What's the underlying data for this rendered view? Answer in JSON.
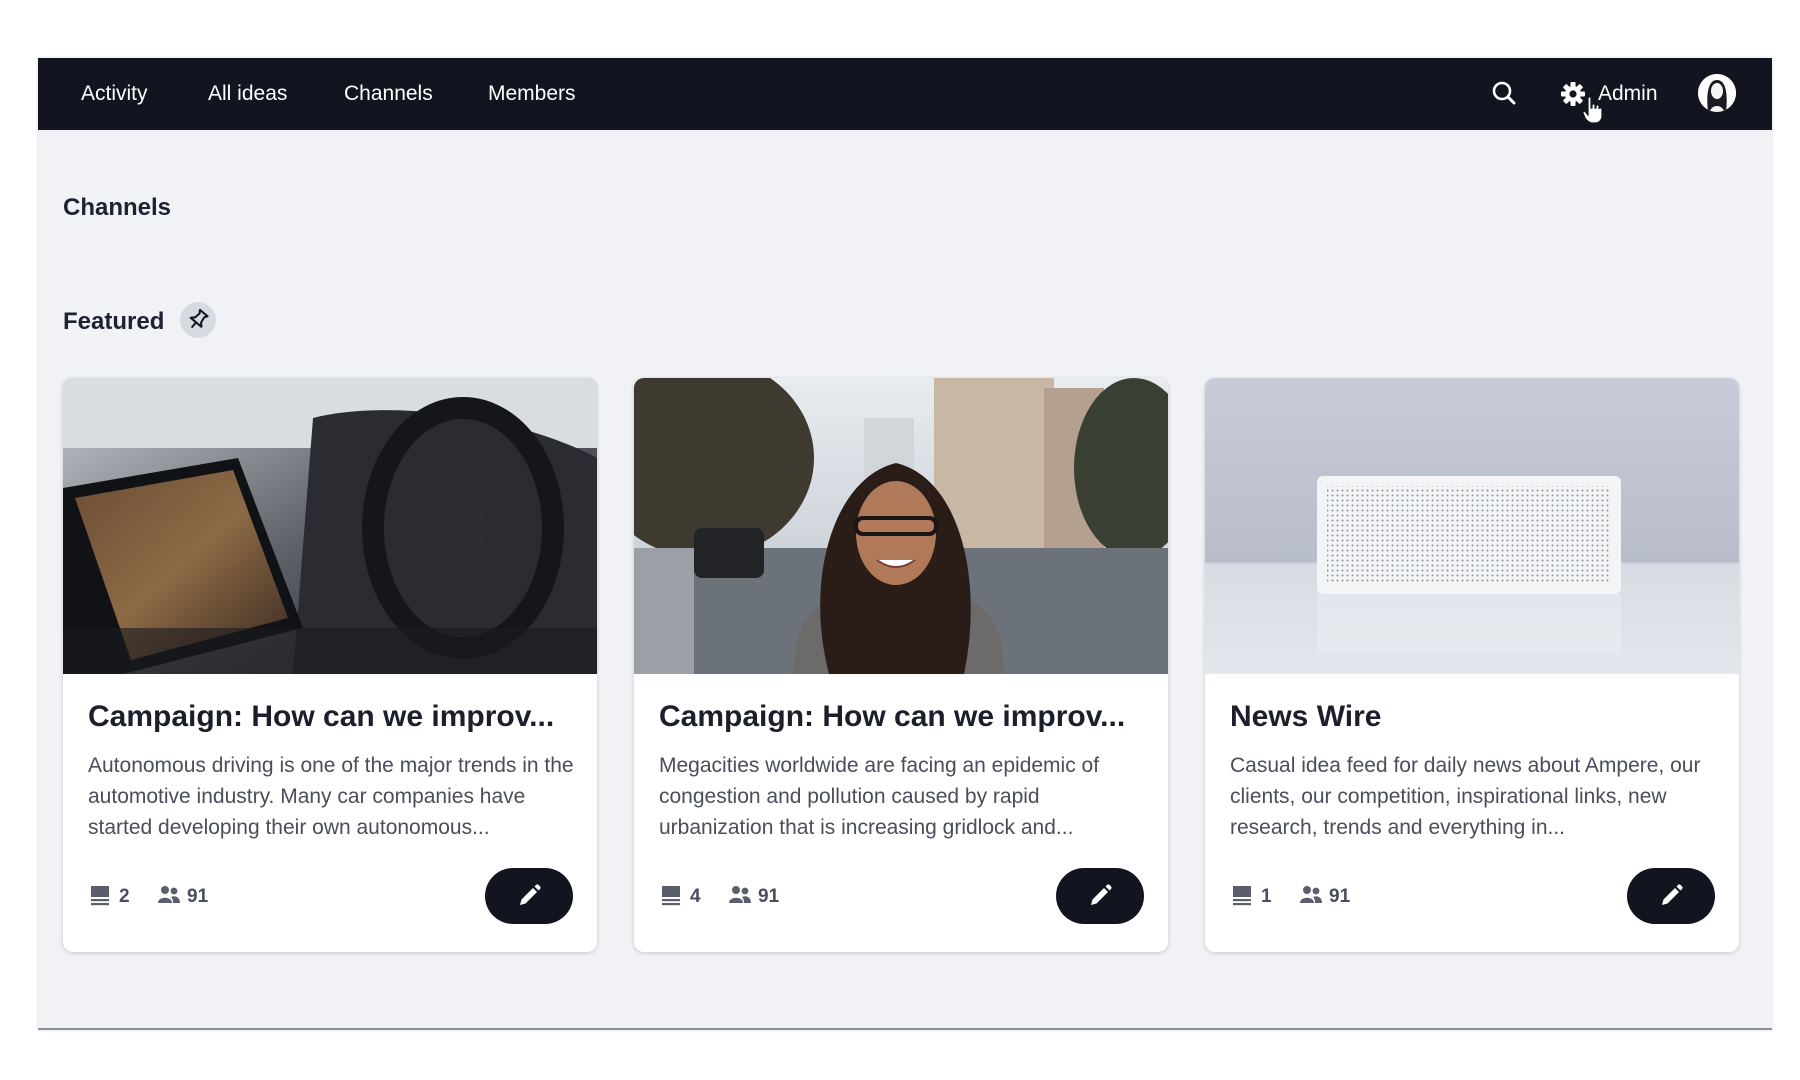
{
  "nav": {
    "items": [
      {
        "label": "Activity"
      },
      {
        "label": "All ideas"
      },
      {
        "label": "Channels"
      },
      {
        "label": "Members"
      }
    ],
    "admin_label": "Admin"
  },
  "page": {
    "title": "Channels",
    "featured_label": "Featured"
  },
  "cards": [
    {
      "title": "Campaign: How can we improv...",
      "description": "Autonomous driving is one of the major trends in the automotive industry. Many car companies have started developing their own autonomous...",
      "ideas_count": "2",
      "members_count": "91",
      "image": "car-interior-photo"
    },
    {
      "title": "Campaign: How can we improv...",
      "description": "Megacities worldwide are facing an epidemic of congestion and pollution caused by rapid urbanization that is increasing gridlock and...",
      "ideas_count": "4",
      "members_count": "91",
      "image": "city-street-portrait-photo"
    },
    {
      "title": "News Wire",
      "description": "Casual idea feed for daily news about Ampere, our clients, our competition, inspirational links, new research, trends and everything in...",
      "ideas_count": "1",
      "members_count": "91",
      "image": "white-speaker-photo"
    }
  ],
  "icons": {
    "search": "search-icon",
    "settings": "gear-icon",
    "pin": "pin-icon",
    "ideas": "ideas-icon",
    "members": "members-icon",
    "edit": "pencil-icon"
  },
  "colors": {
    "navbar": "#12141f",
    "background": "#f0f2f6",
    "button": "#12141f"
  }
}
